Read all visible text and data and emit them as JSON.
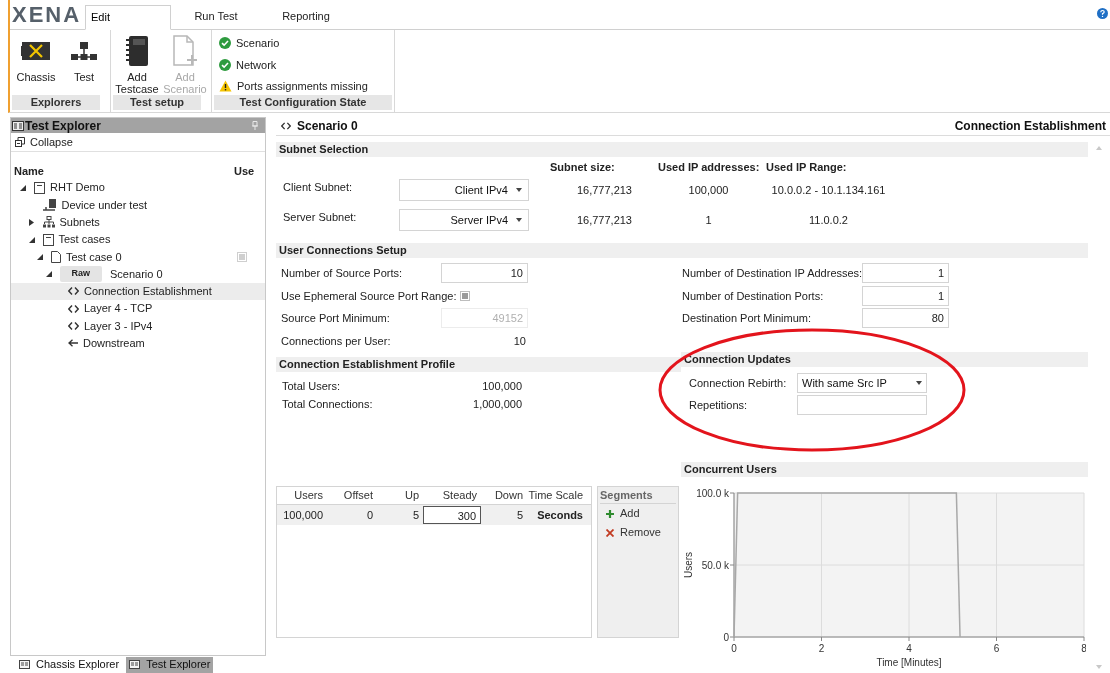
{
  "ribbon": {
    "logo": "XENA",
    "tabs": [
      {
        "label": "Edit",
        "selected": true
      },
      {
        "label": "Run Test",
        "selected": false
      },
      {
        "label": "Reporting",
        "selected": false
      }
    ],
    "groups": [
      {
        "label": "Explorers",
        "kind": "buttons",
        "buttons": [
          {
            "label": "Chassis",
            "kind": "chassis",
            "disabled": false
          },
          {
            "label": "Test",
            "kind": "network",
            "disabled": false
          }
        ]
      },
      {
        "label": "Test setup",
        "kind": "buttons",
        "buttons": [
          {
            "label": "Add Testcase",
            "kind": "notebook",
            "disabled": false
          },
          {
            "label": "Add Scenario",
            "kind": "document",
            "disabled": true
          }
        ]
      },
      {
        "label": "Test Configuration State",
        "kind": "status",
        "items": [
          {
            "label": "Scenario",
            "kind": "ok"
          },
          {
            "label": "Network",
            "kind": "ok"
          },
          {
            "label": "Ports assignments missing",
            "kind": "warning"
          }
        ]
      }
    ]
  },
  "explorer": {
    "title": "Test Explorer",
    "collapse": "Collapse",
    "columns": [
      "Name",
      "Use"
    ],
    "tree": [
      {
        "label": "RHT Demo",
        "kind": "document",
        "expanded": true,
        "selected": false,
        "children": [
          {
            "label": "Device under test",
            "kind": "device",
            "selected": false
          },
          {
            "label": "Subnets",
            "kind": "subnets",
            "expanded": false,
            "selected": false
          },
          {
            "label": "Test cases",
            "kind": "document",
            "expanded": true,
            "selected": false,
            "children": [
              {
                "label": "Test case 0",
                "kind": "page",
                "expanded": true,
                "selected": false,
                "use_box": true,
                "children": [
                  {
                    "label": "Scenario 0",
                    "kind": "raw",
                    "badge": "Raw",
                    "expanded": true,
                    "selected": false,
                    "children": [
                      {
                        "label": "Connection Establishment",
                        "kind": "code",
                        "selected": true
                      },
                      {
                        "label": "Layer 4 - TCP",
                        "kind": "code",
                        "selected": false
                      },
                      {
                        "label": "Layer 3 - IPv4",
                        "kind": "code",
                        "selected": false
                      },
                      {
                        "label": "Downstream",
                        "kind": "arrow",
                        "selected": false
                      }
                    ]
                  }
                ]
              }
            ]
          }
        ]
      }
    ],
    "tabs": [
      {
        "label": "Chassis Explorer",
        "selected": false
      },
      {
        "label": "Test Explorer",
        "selected": true
      }
    ]
  },
  "scenario": {
    "title": "Scenario 0",
    "subtitle": "Connection Establishment",
    "subnet_selection": {
      "title": "Subnet Selection",
      "columns": [
        "Subnet size:",
        "Used IP addresses:",
        "Used IP Range:"
      ],
      "rows": [
        {
          "label": "Client Subnet:",
          "value": "Client IPv4",
          "size": "16,777,213",
          "used": "100,000",
          "range": "10.0.0.2 - 10.1.134.161"
        },
        {
          "label": "Server Subnet:",
          "value": "Server IPv4",
          "size": "16,777,213",
          "used": "1",
          "range": "11.0.0.2"
        }
      ]
    },
    "user_connections": {
      "title": "User Connections Setup",
      "left": [
        {
          "kind": "input",
          "label": "Number of Source Ports:",
          "value": "10",
          "disabled": false
        },
        {
          "kind": "checkbox",
          "label": "Use Ephemeral Source Port Range:",
          "checked": false
        },
        {
          "kind": "input",
          "label": "Source Port Minimum:",
          "value": "49152",
          "disabled": true
        },
        {
          "kind": "text",
          "label": "Connections per User:",
          "value": "10"
        }
      ],
      "right": [
        {
          "kind": "input",
          "label": "Number of Destination IP Addresses:",
          "value": "1",
          "disabled": false
        },
        {
          "kind": "input",
          "label": "Number of Destination Ports:",
          "value": "1",
          "disabled": false
        },
        {
          "kind": "input",
          "label": "Destination Port Minimum:",
          "value": "80",
          "disabled": false
        }
      ]
    },
    "profile": {
      "title": "Connection Establishment Profile",
      "rows": [
        {
          "label": "Total Users:",
          "value": "100,000"
        },
        {
          "label": "Total Connections:",
          "value": "1,000,000"
        }
      ]
    },
    "updates": {
      "title": "Connection Updates",
      "rows": [
        {
          "kind": "select",
          "label": "Connection Rebirth:",
          "value": "With same Src IP"
        },
        {
          "kind": "input",
          "label": "Repetitions:"
        }
      ]
    },
    "segments_table": {
      "columns": [
        "Users",
        "Offset",
        "Up",
        "Steady",
        "Down",
        "Time Scale"
      ],
      "rows": [
        {
          "selected": true,
          "cells": [
            {
              "text": "100,000",
              "focused": false
            },
            {
              "text": "0",
              "focused": false
            },
            {
              "text": "5",
              "focused": false
            },
            {
              "text": "300",
              "focused": true
            },
            {
              "text": "5",
              "focused": false
            },
            {
              "text": "Seconds",
              "focused": false
            }
          ]
        }
      ]
    },
    "segments": {
      "title": "Segments",
      "actions": [
        {
          "label": "Add",
          "kind": "add"
        },
        {
          "label": "Remove",
          "kind": "remove"
        }
      ]
    },
    "concurrent_users": {
      "title": "Concurrent Users",
      "chart_data": {
        "type": "line",
        "xlabel": "Time [Minutes]",
        "ylabel": "Users",
        "x": [
          0,
          0.083,
          5.083,
          5.167
        ],
        "series": [
          {
            "color": "#a8a8a8",
            "values": [
              0,
              100000,
              100000,
              0
            ]
          }
        ],
        "grid": true,
        "xlim": [
          0,
          8
        ],
        "ylim": [
          0,
          100000
        ],
        "xticks": [
          0,
          2,
          4,
          6,
          8
        ],
        "yticks": [
          {
            "value": 0,
            "label": "0"
          },
          {
            "value": 50000,
            "label": "50.0 k"
          },
          {
            "value": 100000,
            "label": "100.0 k"
          }
        ]
      }
    }
  }
}
